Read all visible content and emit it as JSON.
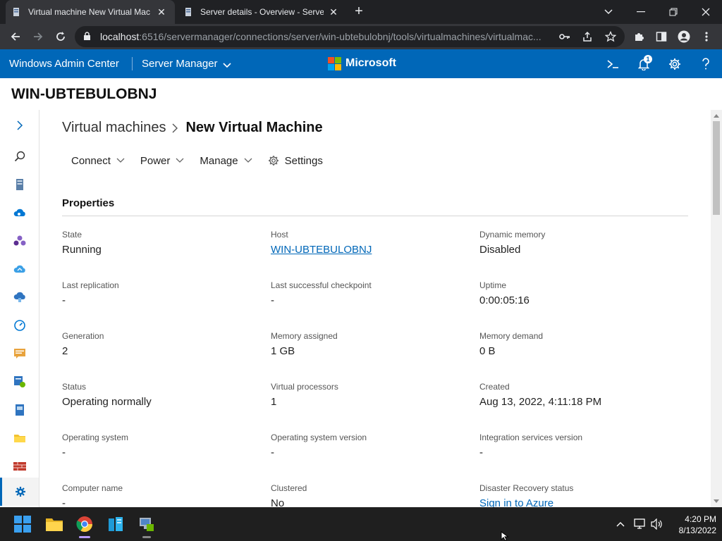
{
  "browser": {
    "tabs": [
      {
        "title": "Virtual machine New Virtual Mac",
        "active": true
      },
      {
        "title": "Server details - Overview - Server",
        "active": false
      }
    ],
    "url_host": "localhost",
    "url_rest": ":6516/servermanager/connections/server/win-ubtebulobnj/tools/virtualmachines/virtualmac..."
  },
  "wac": {
    "brand": "Windows Admin Center",
    "app": "Server Manager",
    "logo_text": "Microsoft",
    "notification_count": "1"
  },
  "server": {
    "name": "WIN-UBTEBULOBNJ"
  },
  "breadcrumb": {
    "parent": "Virtual machines",
    "current": "New Virtual Machine"
  },
  "commands": {
    "connect": "Connect",
    "power": "Power",
    "manage": "Manage",
    "settings": "Settings"
  },
  "section": {
    "title": "Properties"
  },
  "properties": [
    {
      "label": "State",
      "value": "Running"
    },
    {
      "label": "Host",
      "value": "WIN-UBTEBULOBNJ",
      "link": true
    },
    {
      "label": "Dynamic memory",
      "value": "Disabled"
    },
    {
      "label": "Last replication",
      "value": "-"
    },
    {
      "label": "Last successful checkpoint",
      "value": "-"
    },
    {
      "label": "Uptime",
      "value": "0:00:05:16"
    },
    {
      "label": "Generation",
      "value": "2"
    },
    {
      "label": "Memory assigned",
      "value": "1 GB"
    },
    {
      "label": "Memory demand",
      "value": "0 B"
    },
    {
      "label": "Status",
      "value": "Operating normally"
    },
    {
      "label": "Virtual processors",
      "value": "1"
    },
    {
      "label": "Created",
      "value": "Aug 13, 2022, 4:11:18 PM"
    },
    {
      "label": "Operating system",
      "value": "-"
    },
    {
      "label": "Operating system version",
      "value": "-"
    },
    {
      "label": "Integration services version",
      "value": "-"
    },
    {
      "label": "Computer name",
      "value": "-"
    },
    {
      "label": "Clustered",
      "value": "No"
    },
    {
      "label": "Disaster Recovery status",
      "value": "Sign in to Azure",
      "link": true
    }
  ],
  "taskbar": {
    "time": "4:20 PM",
    "date": "8/13/2022"
  },
  "colors": {
    "accent": "#0067b8",
    "tabstrip": "#202124",
    "toolbar": "#35363a",
    "taskbar": "#1f1f1f"
  }
}
